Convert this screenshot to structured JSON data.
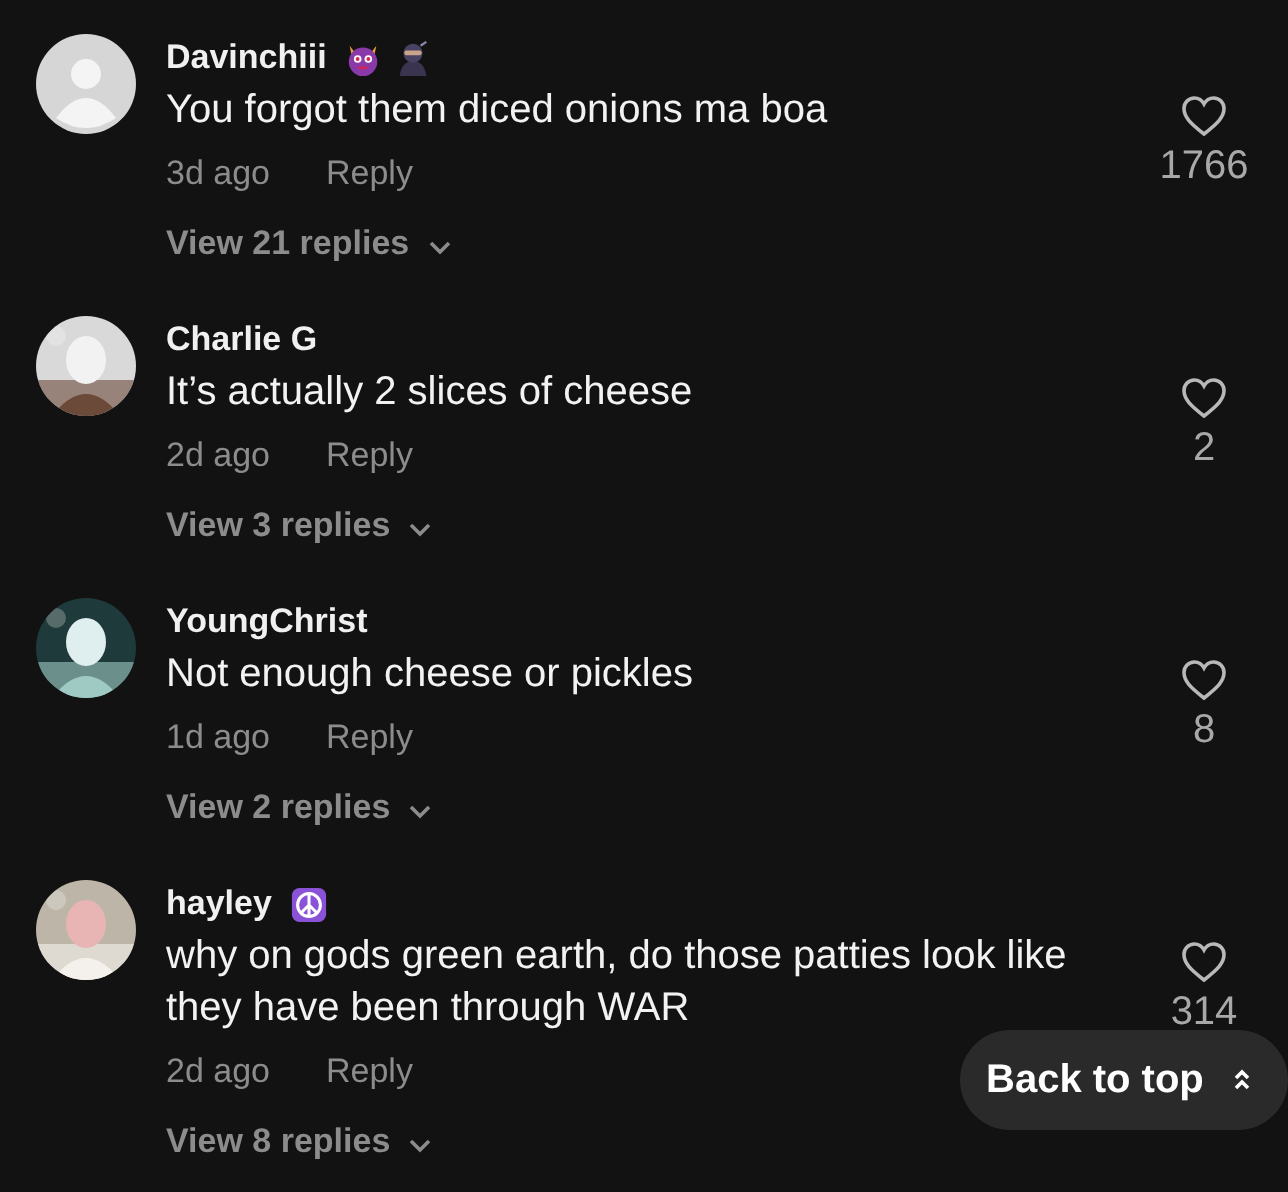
{
  "comments": [
    {
      "avatar": {
        "kind": "default"
      },
      "username": "Davinchiii",
      "text": "You forgot them diced onions ma boa",
      "time": "3d ago",
      "reply": "Reply",
      "view_replies": "View 21 replies",
      "liked": false,
      "likes": "1766"
    },
    {
      "username": "Charlie G",
      "text": "It’s actually 2 slices of cheese",
      "time": "2d ago",
      "reply": "Reply",
      "view_replies": "View 3 replies",
      "liked": false,
      "likes": "2"
    },
    {
      "username": "YoungChrist",
      "text": "Not enough cheese or pickles",
      "time": "1d ago",
      "reply": "Reply",
      "view_replies": "View 2 replies",
      "liked": false,
      "likes": "8"
    },
    {
      "username": "hayley",
      "text": "why on gods green earth, do those patties look like they have been through WAR",
      "time": "2d ago",
      "reply": "Reply",
      "view_replies": "View 8 replies",
      "liked": false,
      "likes": "314"
    }
  ],
  "back_to_top": {
    "label": "Back to top"
  }
}
